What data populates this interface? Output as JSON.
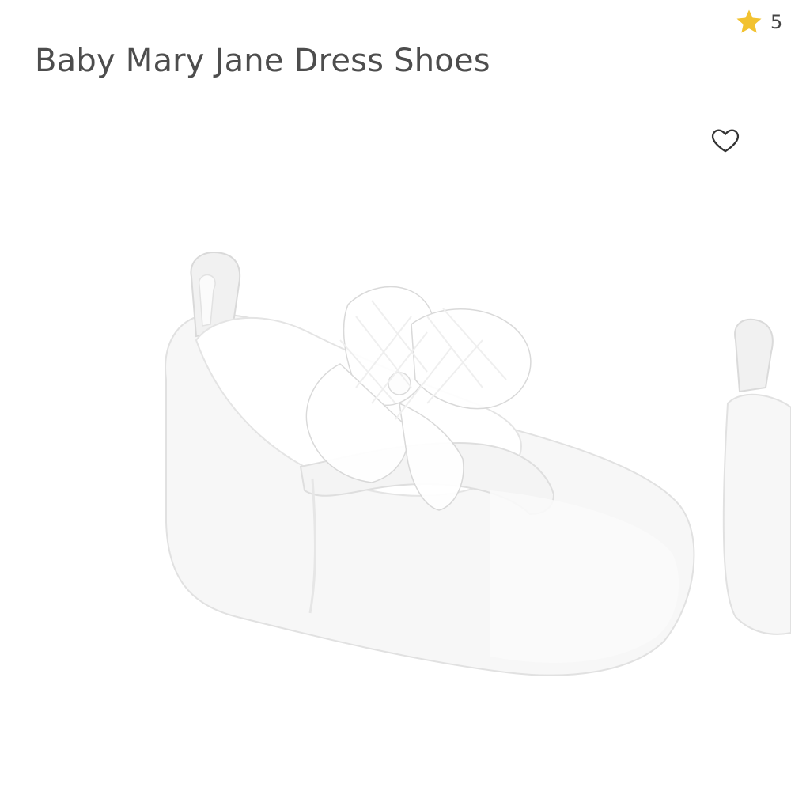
{
  "product": {
    "title": "Baby Mary Jane Dress Shoes",
    "rating_value": "5",
    "image_alt": "White baby Mary Jane shoe with tulle bow"
  },
  "icons": {
    "rating": "star-icon",
    "wishlist": "heart-outline-icon"
  },
  "colors": {
    "star": "#F2C230",
    "title_text": "#4D4D4D",
    "background": "#FFFFFF"
  }
}
